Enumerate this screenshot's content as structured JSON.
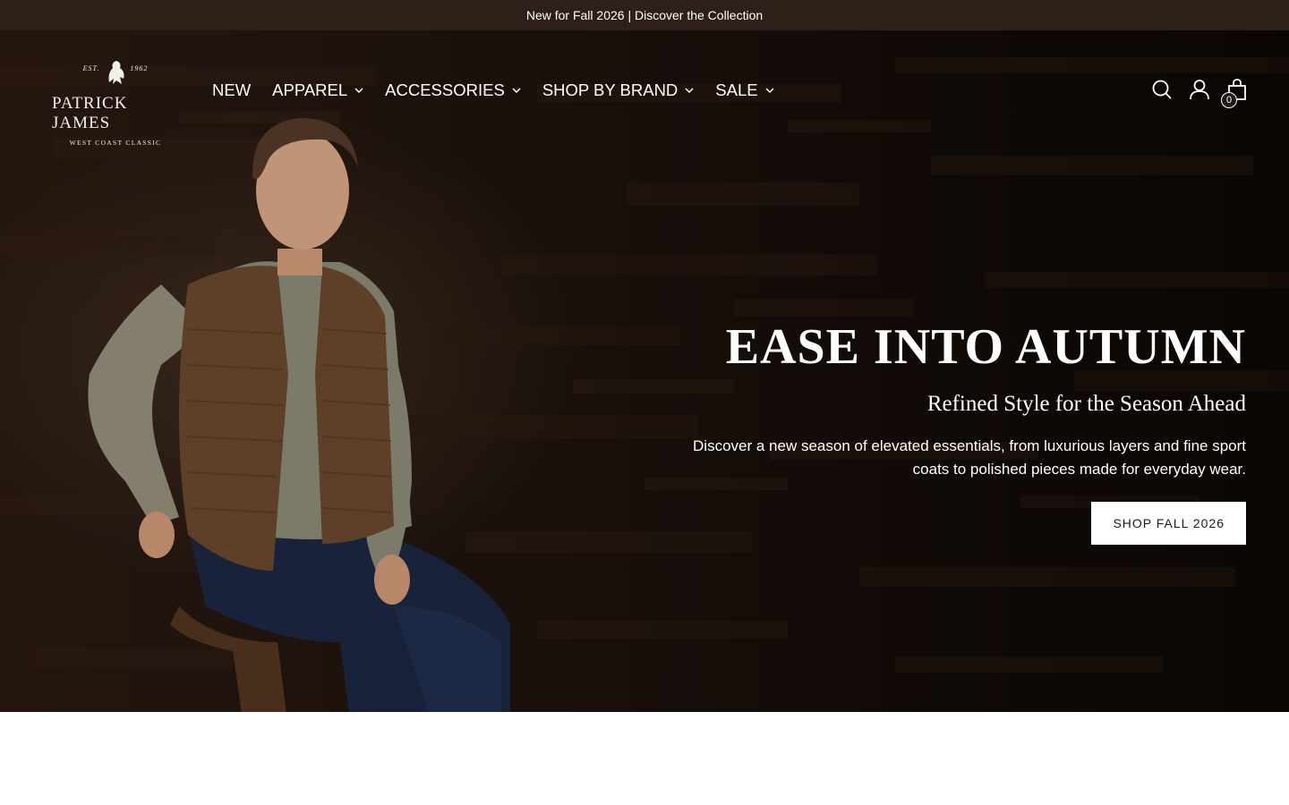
{
  "announcement": {
    "text": "New for Fall 2026 | Discover the Collection"
  },
  "logo": {
    "est": "EST.",
    "year": "1962",
    "name": "PATRICK JAMES",
    "tagline": "WEST COAST CLASSIC"
  },
  "nav": {
    "items": [
      {
        "label": "NEW",
        "dropdown": false
      },
      {
        "label": "APPAREL",
        "dropdown": true
      },
      {
        "label": "ACCESSORIES",
        "dropdown": true
      },
      {
        "label": "SHOP BY BRAND",
        "dropdown": true
      },
      {
        "label": "SALE",
        "dropdown": true
      }
    ]
  },
  "header_icons": {
    "search": "search-icon",
    "account": "account-icon",
    "cart": "cart-icon",
    "cart_count": "0"
  },
  "hero": {
    "title": "EASE INTO AUTUMN",
    "subtitle": "Refined Style for the Season Ahead",
    "description_line1": "Discover a new season of elevated essentials, from luxurious layers and fine sport",
    "description_line2": "coats to polished pieces made for everyday wear.",
    "button_label": "SHOP FALL 2026"
  },
  "colors": {
    "announcement_bg": "#2e1f18",
    "hero_bg": "#1e130d",
    "button_bg": "#ffffff",
    "button_text": "#1b1b1b"
  }
}
